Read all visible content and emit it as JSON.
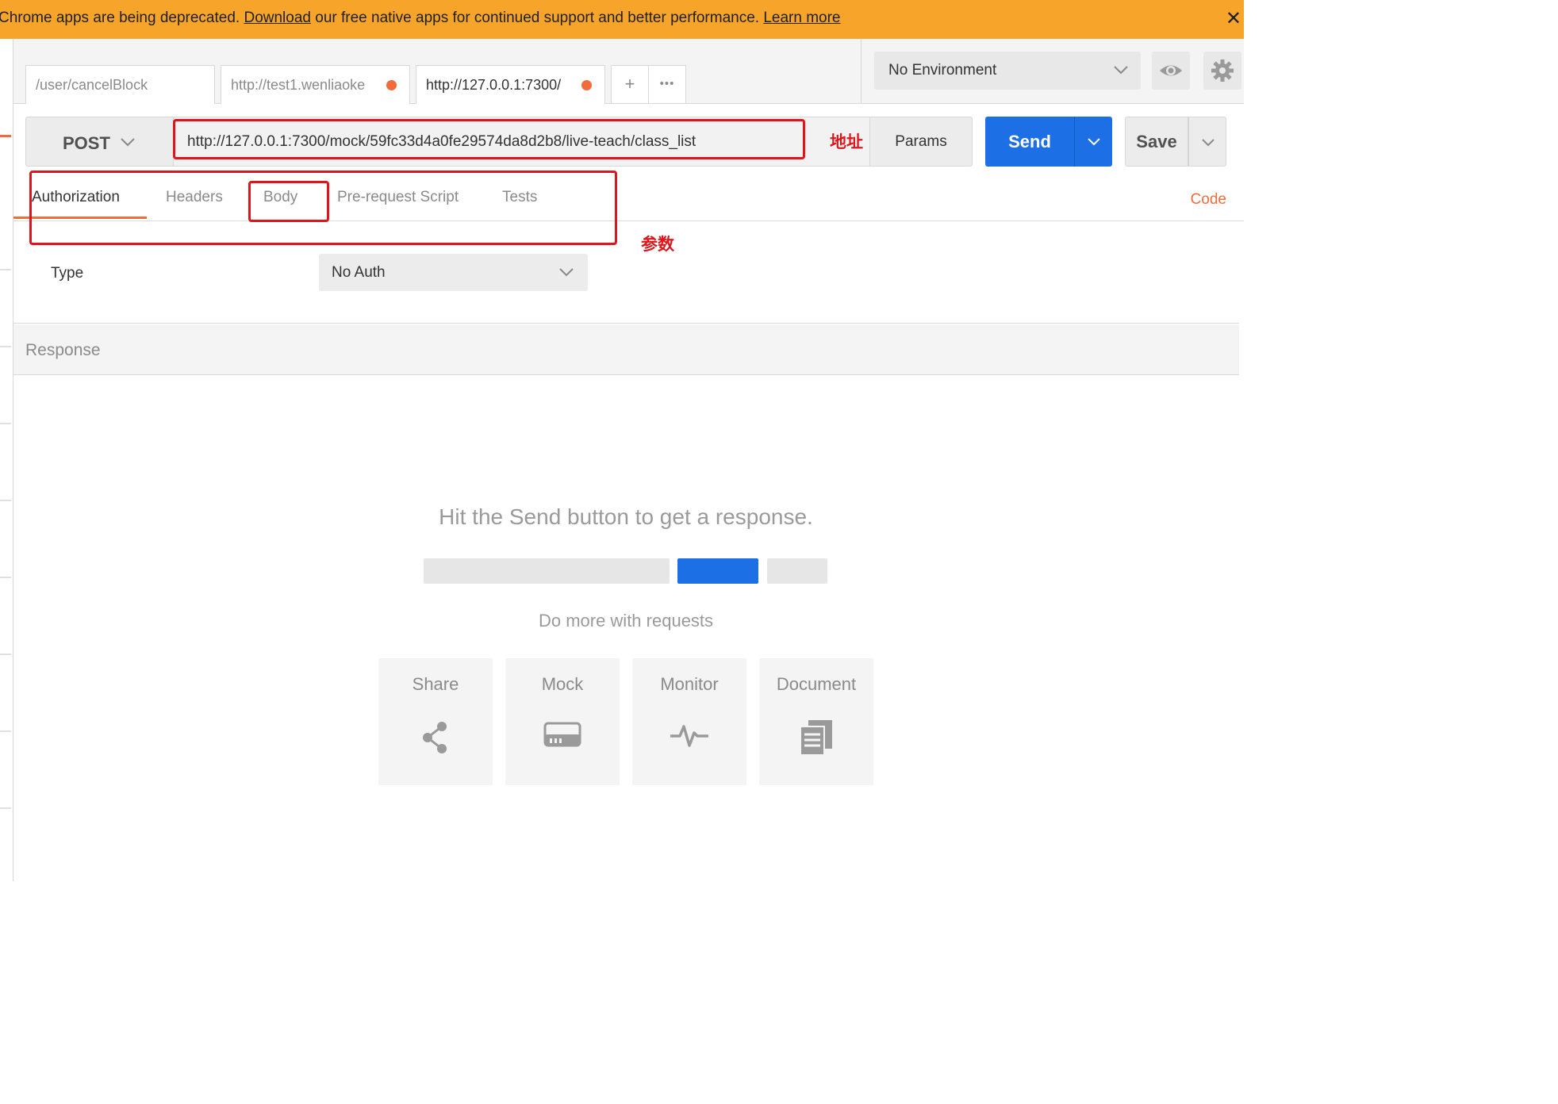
{
  "banner": {
    "text_before": "Chrome apps are being deprecated. ",
    "download_link": "Download",
    "text_after": " our free native apps for continued support and better performance. ",
    "learn_more_link": "Learn more",
    "close_glyph": "✕"
  },
  "request_tabs": [
    {
      "label": "/user/cancelBlock",
      "unsaved": false
    },
    {
      "label": "http://test1.wenliaoke",
      "unsaved": true
    },
    {
      "label": "http://127.0.0.1:7300/",
      "unsaved": true,
      "active": true
    }
  ],
  "tab_controls": {
    "add_glyph": "+",
    "more_glyph": "•••"
  },
  "environment": {
    "selected": "No Environment",
    "eye_icon": "eye-icon",
    "settings_icon": "gear-icon"
  },
  "request": {
    "method": "POST",
    "url": "http://127.0.0.1:7300/mock/59fc33d4a0fe29574da8d2b8/live-teach/class_list",
    "params_label": "Params",
    "send_label": "Send",
    "save_label": "Save"
  },
  "annotations": {
    "url_note": "地址",
    "params_note": "参数",
    "color": "#e0151b"
  },
  "sub_tabs": {
    "items": [
      "Authorization",
      "Headers",
      "Body",
      "Pre-request Script",
      "Tests"
    ],
    "active": "Authorization",
    "code_label": "Code"
  },
  "auth": {
    "type_label": "Type",
    "selected": "No Auth"
  },
  "response": {
    "header": "Response",
    "empty_title": "Hit the Send button to get a response.",
    "do_more": "Do more with requests",
    "cards": [
      {
        "label": "Share",
        "icon": "share-icon"
      },
      {
        "label": "Mock",
        "icon": "server-icon"
      },
      {
        "label": "Monitor",
        "icon": "pulse-icon"
      },
      {
        "label": "Document",
        "icon": "document-icon"
      }
    ]
  },
  "colors": {
    "banner": "#f7a52a",
    "accent": "#f26b3a",
    "primary": "#1d6fe6"
  }
}
